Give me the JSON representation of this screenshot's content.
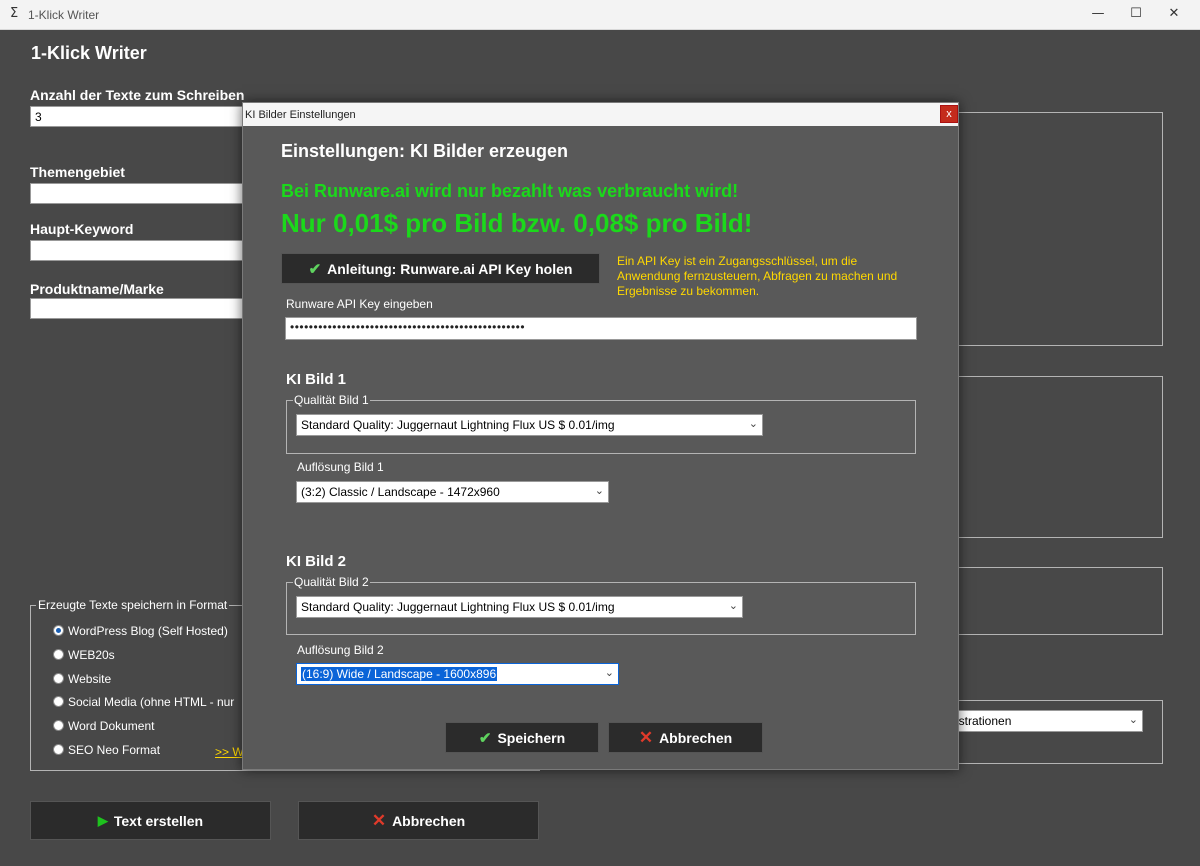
{
  "window": {
    "title": "1-Klick Writer",
    "app_icon": "Σ",
    "minimize": "—",
    "maximize": "☐",
    "close": "✕"
  },
  "main": {
    "heading": "1-Klick Writer",
    "count_label": "Anzahl der Texte zum Schreiben",
    "count_value": "3",
    "topic_label": "Themengebiet",
    "topic_value": "",
    "keyword_label": "Haupt-Keyword",
    "keyword_value": "",
    "product_label": "Produktname/Marke",
    "product_value": "",
    "format_group": {
      "legend": "Erzeugte Texte speichern in Format",
      "options": [
        {
          "label": "WordPress Blog (Self Hosted)",
          "checked": true
        },
        {
          "label": "WEB20s",
          "checked": false
        },
        {
          "label": "Website",
          "checked": false
        },
        {
          "label": "Social Media (ohne HTML - nur",
          "checked": false
        },
        {
          "label": "Word Dokument",
          "checked": false
        },
        {
          "label": "SEO Neo Format",
          "checked": false
        }
      ],
      "link": ">> W"
    },
    "create_button": "Text erstellen",
    "cancel_button": "Abbrechen",
    "partial_combo_value": "ustrationen"
  },
  "dialog": {
    "title": "KI Bilder Einstellungen",
    "close_label": "x",
    "heading": "Einstellungen: KI Bilder erzeugen",
    "promo_line1": "Bei Runware.ai wird nur bezahlt was verbraucht wird!",
    "promo_line2": "Nur 0,01$ pro Bild bzw. 0,08$ pro Bild!",
    "guide_button": "Anleitung: Runware.ai API Key holen",
    "api_info": "Ein API Key ist ein Zugangsschlüssel, um die Anwendung fernzusteuern, Abfragen zu machen und Ergebnisse zu bekommen.",
    "api_label": "Runware API Key eingeben",
    "api_value": "••••••••••••••••••••••••••••••••••••••••••••••••••",
    "image1": {
      "title": "KI Bild 1",
      "quality_legend": "Qualität Bild 1",
      "quality_value": "Standard Quality: Juggernaut Lightning Flux US $ 0.01/img",
      "resolution_label": "Auflösung Bild 1",
      "resolution_value": "(3:2) Classic / Landscape - 1472x960"
    },
    "image2": {
      "title": "KI Bild 2",
      "quality_legend": "Qualität Bild 2",
      "quality_value": "Standard Quality: Juggernaut Lightning Flux US $ 0.01/img",
      "resolution_label": "Auflösung Bild 2",
      "resolution_value": "(16:9) Wide / Landscape - 1600x896"
    },
    "save_button": "Speichern",
    "cancel_button": "Abbrechen"
  },
  "icons": {
    "check": "✔",
    "cross": "✕",
    "play": "▶",
    "chevron": "⌄"
  }
}
